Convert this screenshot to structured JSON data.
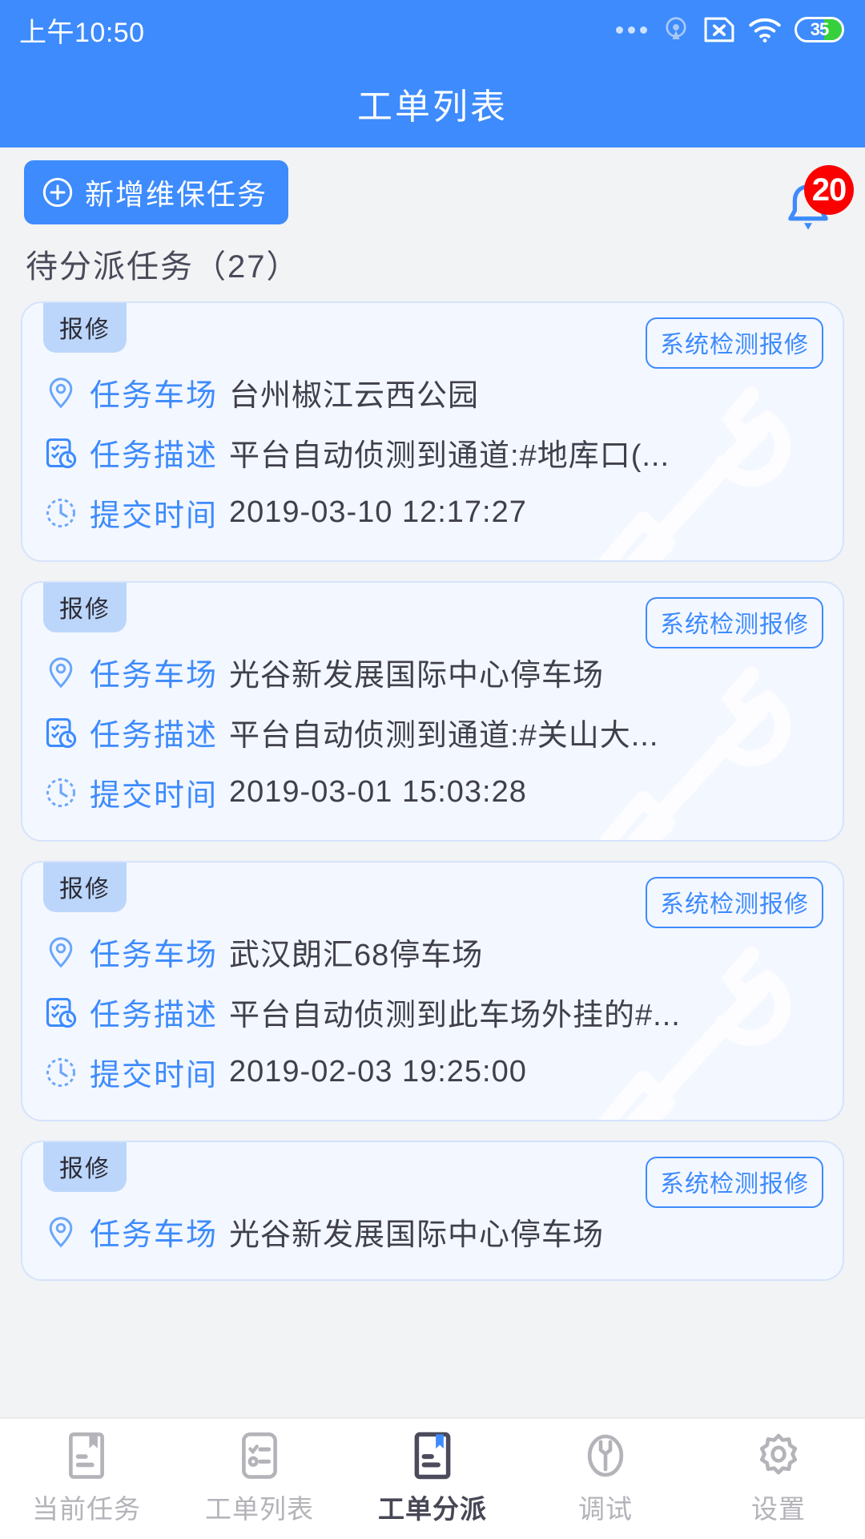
{
  "statusbar": {
    "time": "上午10:50",
    "battery_level": "35",
    "icons": [
      "more-dots-icon",
      "location-beacon-icon",
      "sim-disabled-icon",
      "wifi-icon",
      "battery-icon"
    ]
  },
  "header": {
    "title": "工单列表"
  },
  "toolbar": {
    "add_label": "新增维保任务",
    "add_icon": "plus-circle-icon",
    "bell_icon": "bell-icon",
    "notification_count": "20"
  },
  "section": {
    "title": "待分派任务（27）"
  },
  "labels": {
    "parking_lot": "任务车场",
    "description": "任务描述",
    "submit_time": "提交时间"
  },
  "cards": [
    {
      "tag": "报修",
      "type_badge": "系统检测报修",
      "parking_lot": "台州椒江云西公园",
      "description": "平台自动侦测到通道:#地库口(...",
      "submit_time": "2019-03-10 12:17:27"
    },
    {
      "tag": "报修",
      "type_badge": "系统检测报修",
      "parking_lot": "光谷新发展国际中心停车场",
      "description": "平台自动侦测到通道:#关山大...",
      "submit_time": "2019-03-01 15:03:28"
    },
    {
      "tag": "报修",
      "type_badge": "系统检测报修",
      "parking_lot": "武汉朗汇68停车场",
      "description": "平台自动侦测到此车场外挂的#...",
      "submit_time": "2019-02-03 19:25:00"
    },
    {
      "tag": "报修",
      "type_badge": "系统检测报修",
      "parking_lot": "光谷新发展国际中心停车场",
      "description": "",
      "submit_time": ""
    }
  ],
  "tabbar": {
    "items": [
      {
        "label": "当前任务",
        "icon": "document-bookmark-icon",
        "active": false
      },
      {
        "label": "工单列表",
        "icon": "checklist-icon",
        "active": false
      },
      {
        "label": "工单分派",
        "icon": "document-bookmark-filled-icon",
        "active": true
      },
      {
        "label": "调试",
        "icon": "wrench-circle-icon",
        "active": false
      },
      {
        "label": "设置",
        "icon": "gear-icon",
        "active": false
      }
    ]
  },
  "colors": {
    "brand_blue": "#3d8bfd",
    "card_bg": "#f3f7ff",
    "tag_bg": "#bcd6fb",
    "badge_red": "#fc0000",
    "page_bg": "#f2f3f5"
  }
}
